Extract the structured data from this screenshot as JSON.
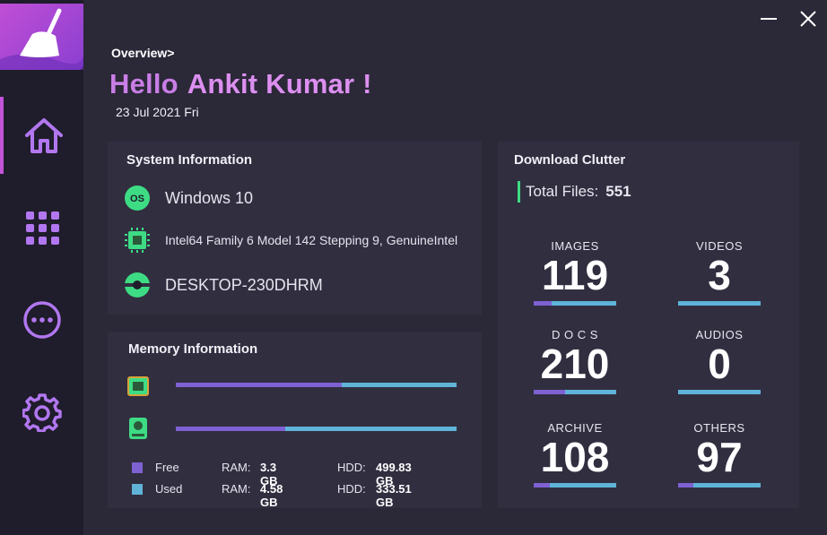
{
  "header": {
    "breadcrumb": "Overview>",
    "greeting": "Hello",
    "user_name": "Ankit Kumar !",
    "date": "23 Jul 2021 Fri"
  },
  "window": {
    "minimize_icon": "minimize-icon",
    "close_icon": "close-icon"
  },
  "sidebar": {
    "items": [
      {
        "name": "home",
        "icon": "home-icon",
        "active": true
      },
      {
        "name": "apps",
        "icon": "grid-icon",
        "active": false
      },
      {
        "name": "more",
        "icon": "more-icon",
        "active": false
      },
      {
        "name": "settings",
        "icon": "gear-icon",
        "active": false
      }
    ]
  },
  "system_info": {
    "title": "System Information",
    "os": "Windows 10",
    "os_badge": "OS",
    "cpu": "Intel64 Family 6 Model 142 Stepping 9, GenuineIntel",
    "host": "DESKTOP-230DHRM"
  },
  "memory_info": {
    "title": "Memory Information",
    "ram_free_fraction": 0.59,
    "hdd_free_fraction": 0.39,
    "legend": {
      "free_label": "Free",
      "used_label": "Used",
      "ram_label": "RAM:",
      "hdd_label": "HDD:",
      "ram_free": "3.3 GB",
      "ram_used": "4.58 GB",
      "hdd_free": "499.83 GB",
      "hdd_used": "333.51 GB"
    }
  },
  "download_clutter": {
    "title": "Download Clutter",
    "total_label": "Total Files:",
    "total_value": "551",
    "categories": [
      {
        "label": "IMAGES",
        "value": "119",
        "fraction": 0.22
      },
      {
        "label": "VIDEOS",
        "value": "3",
        "fraction": 0.0
      },
      {
        "label": "D O C S",
        "value": "210",
        "fraction": 0.38
      },
      {
        "label": "AUDIOS",
        "value": "0",
        "fraction": 0.0
      },
      {
        "label": "ARCHIVE",
        "value": "108",
        "fraction": 0.2
      },
      {
        "label": "OTHERS",
        "value": "97",
        "fraction": 0.18
      }
    ]
  },
  "colors": {
    "accent": "#c353d8",
    "free": "#7e61d2",
    "used": "#5fb4d8",
    "ok": "#3ddc84"
  }
}
